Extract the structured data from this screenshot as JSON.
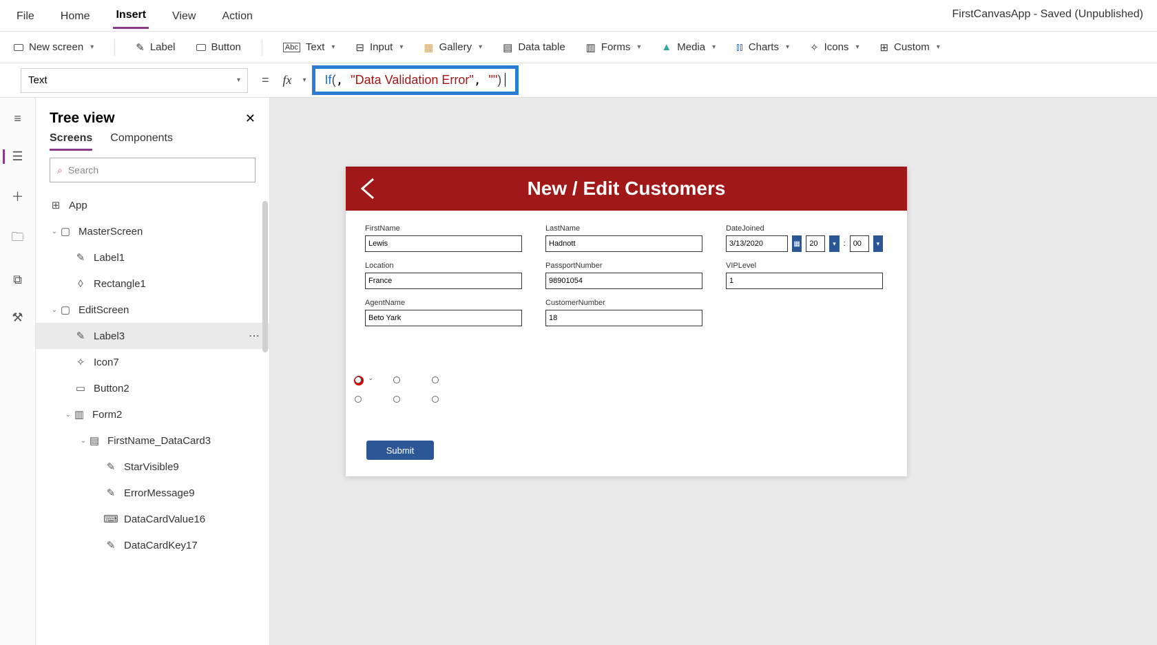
{
  "app_title": "FirstCanvasApp - Saved (Unpublished)",
  "menu": {
    "file": "File",
    "home": "Home",
    "insert": "Insert",
    "view": "View",
    "action": "Action"
  },
  "ribbon": {
    "new_screen": "New screen",
    "label": "Label",
    "button": "Button",
    "text": "Text",
    "input": "Input",
    "gallery": "Gallery",
    "data_table": "Data table",
    "forms": "Forms",
    "media": "Media",
    "charts": "Charts",
    "icons": "Icons",
    "custom": "Custom"
  },
  "formula_bar": {
    "property": "Text",
    "fn": "If",
    "arg_str1": "\"Data Validation Error\"",
    "arg_str2": "\"\""
  },
  "tree": {
    "title": "Tree view",
    "tab_screens": "Screens",
    "tab_components": "Components",
    "search_placeholder": "Search",
    "items": {
      "app": "App",
      "master": "MasterScreen",
      "label1": "Label1",
      "rect1": "Rectangle1",
      "edit": "EditScreen",
      "label3": "Label3",
      "icon7": "Icon7",
      "button2": "Button2",
      "form2": "Form2",
      "dc": "FirstName_DataCard3",
      "starv": "StarVisible9",
      "err": "ErrorMessage9",
      "dcv": "DataCardValue16",
      "dck": "DataCardKey17"
    }
  },
  "screen": {
    "title": "New / Edit Customers",
    "fields": {
      "firstname": {
        "label": "FirstName",
        "value": "Lewis"
      },
      "lastname": {
        "label": "LastName",
        "value": "Hadnott"
      },
      "datejoined": {
        "label": "DateJoined",
        "date": "3/13/2020",
        "hour": "20",
        "minsep": ":",
        "min": "00"
      },
      "location": {
        "label": "Location",
        "value": "France"
      },
      "passport": {
        "label": "PassportNumber",
        "value": "98901054"
      },
      "viplevel": {
        "label": "VIPLevel",
        "value": "1"
      },
      "agent": {
        "label": "AgentName",
        "value": "Beto Yark"
      },
      "custnum": {
        "label": "CustomerNumber",
        "value": "18"
      }
    },
    "submit": "Submit"
  }
}
